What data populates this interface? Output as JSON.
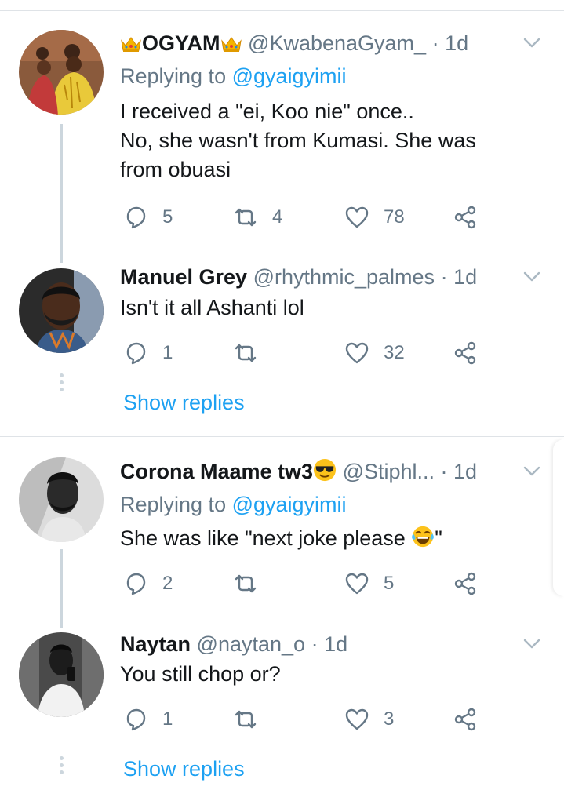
{
  "tweets": [
    {
      "name": "OGYAM",
      "handle": "@KwabenaGyam_",
      "time": "· 1d",
      "replying_prefix": "Replying to ",
      "replying_handle": "@gyaigyimii",
      "lines": [
        "I received a \"ei, Koo nie\" once..",
        "No, she wasn't from Kumasi. She was",
        "from obuasi"
      ],
      "replies": "5",
      "retweets": "4",
      "likes": "78"
    },
    {
      "name": "Manuel Grey",
      "handle": "@rhythmic_palmes",
      "time": "· 1d",
      "lines": [
        "Isn't it all Ashanti lol"
      ],
      "replies": "1",
      "retweets": "",
      "likes": "32",
      "show_replies": "Show replies"
    },
    {
      "name": "Corona Maame tw3",
      "handle": "@Stiphl...",
      "time": "· 1d",
      "replying_prefix": "Replying to ",
      "replying_handle": "@gyaigyimii",
      "text_before": "She was like \"next joke please ",
      "text_after": "\"",
      "replies": "2",
      "retweets": "",
      "likes": "5"
    },
    {
      "name": "Naytan",
      "handle": "@naytan_o",
      "time": "· 1d",
      "lines": [
        "You still chop or?"
      ],
      "replies": "1",
      "retweets": "",
      "likes": "3",
      "show_replies": "Show replies"
    }
  ],
  "colors": {
    "link": "#1da1f2",
    "muted": "#657786",
    "text": "#14171a",
    "thread_line": "#ccd6dd"
  },
  "icons": [
    "crown-emoji",
    "sunglasses-emoji",
    "tears-of-joy-emoji",
    "reply-icon",
    "retweet-icon",
    "like-icon",
    "share-icon",
    "chevron-down-icon"
  ]
}
